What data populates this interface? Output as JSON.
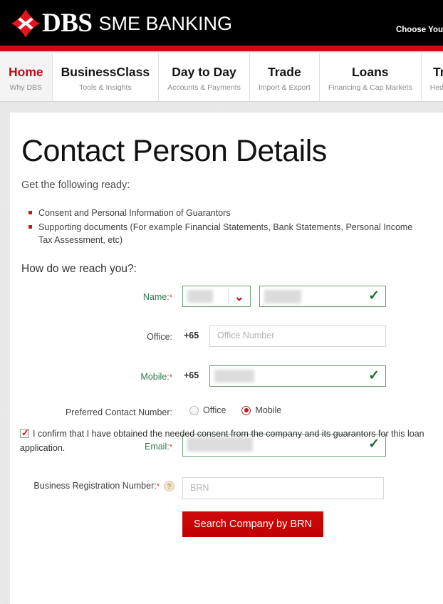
{
  "header": {
    "logo_mark": "dbs-diamond-logo",
    "brand_primary": "DBS",
    "brand_secondary": "SME BANKING",
    "country_selector": "Choose You",
    "accent_red": "#cf0a12",
    "banner_bg": "#000000"
  },
  "nav": {
    "items": [
      {
        "title": "Home",
        "subtitle": "Why DBS",
        "active": true
      },
      {
        "title": "BusinessClass",
        "subtitle": "Tools & Insights",
        "active": false
      },
      {
        "title": "Day to Day",
        "subtitle": "Accounts & Payments",
        "active": false
      },
      {
        "title": "Trade",
        "subtitle": "Import & Export",
        "active": false
      },
      {
        "title": "Loans",
        "subtitle": "Financing & Cap Markets",
        "active": false
      },
      {
        "title": "Tr",
        "subtitle": "Hedg",
        "active": false
      }
    ]
  },
  "main": {
    "title": "Contact Person Details",
    "lead": "Get the following ready:",
    "ready_items": [
      "Consent and Personal Information of Guarantors",
      "Supporting documents (For example Financial Statements, Bank Statements, Personal Income Tax Assessment, etc)"
    ],
    "section_question": "How do we reach you?:",
    "form": {
      "name": {
        "label": "Name:",
        "required": "*",
        "salutation_value": "",
        "name_value": "",
        "valid": true,
        "caret_icon": "chevron-down-icon",
        "valid_icon": "check-icon"
      },
      "office": {
        "label": "Office:",
        "required": "",
        "country_code": "+65",
        "placeholder": "Office Number",
        "value": "",
        "valid": false
      },
      "mobile": {
        "label": "Mobile:",
        "required": "*",
        "country_code": "+65",
        "value": "",
        "valid": true,
        "valid_icon": "check-icon"
      },
      "preferred_contact": {
        "label": "Preferred Contact Number:",
        "options": [
          "Office",
          "Mobile"
        ],
        "selected": "Mobile"
      },
      "email": {
        "label": "Email:",
        "required": "*",
        "value": "",
        "valid": true,
        "valid_icon": "check-icon"
      },
      "consent": {
        "checked": true,
        "text": "I confirm that I have obtained the needed consent from the company and its guarantors for this loan application."
      },
      "brn": {
        "label": "Business Registration Number:",
        "required": "*",
        "help_icon": "question-mark-icon",
        "placeholder": "BRN",
        "value": ""
      },
      "search_button": "Search Company by BRN"
    }
  },
  "colors": {
    "brand_red": "#cc0000",
    "valid_green": "#2f7d4f",
    "required_red": "#e2333f",
    "bullet_red": "#bb1c22"
  }
}
